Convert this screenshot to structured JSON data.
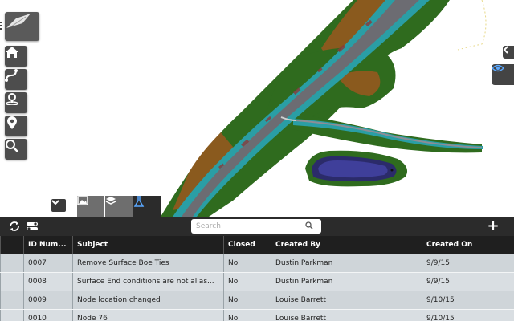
{
  "viewer": {
    "toolbar": [
      {
        "name": "view-cube",
        "icon": "road-perspective-icon"
      },
      {
        "name": "home",
        "icon": "home-icon"
      },
      {
        "name": "alignment",
        "icon": "alignment-path-icon"
      },
      {
        "name": "location",
        "icon": "location-search-icon"
      },
      {
        "name": "marker",
        "icon": "map-marker-icon"
      },
      {
        "name": "zoom",
        "icon": "magnify-icon"
      }
    ],
    "right_tabs": [
      {
        "name": "collapse-right",
        "icon": "chevron-left-icon"
      },
      {
        "name": "visibility",
        "icon": "eye-icon"
      }
    ],
    "bottom_tabs": [
      {
        "name": "images",
        "icon": "image-icon",
        "active": false
      },
      {
        "name": "layers",
        "icon": "layers-icon",
        "active": false
      },
      {
        "name": "issues",
        "icon": "flask-icon",
        "active": true
      }
    ]
  },
  "panel": {
    "search": {
      "placeholder": "Search"
    },
    "add_label": "+",
    "columns": [
      "",
      "ID Num...",
      "Subject",
      "Closed",
      "Created By",
      "Created On"
    ],
    "rows": [
      {
        "id": "0007",
        "subject": "Remove Surface Boe Ties",
        "closed": "No",
        "created_by": "Dustin Parkman",
        "created_on": "9/9/15"
      },
      {
        "id": "0008",
        "subject": "Surface End conditions are not alias...",
        "closed": "No",
        "created_by": "Dustin Parkman",
        "created_on": "9/9/15"
      },
      {
        "id": "0009",
        "subject": "Node location changed",
        "closed": "No",
        "created_by": "Louise Barrett",
        "created_on": "9/10/15"
      },
      {
        "id": "0010",
        "subject": "Node 76",
        "closed": "No",
        "created_by": "Louise Barrett",
        "created_on": "9/10/15"
      }
    ]
  },
  "colors": {
    "toolbar_bg": "#4d4d4d",
    "panel_bg": "#2b2b2b",
    "row_bg": "#d9dee2",
    "terrain_green": "#2f6b1e",
    "terrain_brown": "#8a5a1e",
    "road_teal": "#2a9ea5",
    "road_gray": "#6c6c72"
  }
}
